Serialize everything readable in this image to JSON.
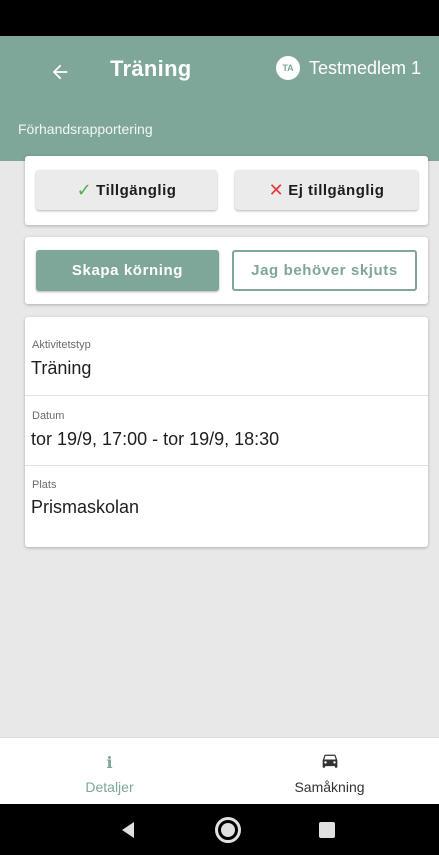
{
  "header": {
    "title": "Träning",
    "avatar_initials": "TA",
    "user_name": "Testmedlem 1",
    "subtitle": "Förhandsrapportering",
    "back_icon": "arrow-left-icon"
  },
  "availability": {
    "available_mark": "✓",
    "available_label": "Tillgänglig",
    "unavailable_mark": "✕",
    "unavailable_label": "Ej tillgänglig"
  },
  "carpool_actions": {
    "create_label": "Skapa körning",
    "need_ride_label": "Jag behöver skjuts"
  },
  "details": [
    {
      "label": "Aktivitetstyp",
      "value": "Träning"
    },
    {
      "label": "Datum",
      "value": "tor 19/9, 17:00 - tor 19/9, 18:30"
    },
    {
      "label": "Plats",
      "value": "Prismaskolan"
    }
  ],
  "bottom_nav": {
    "details_icon": "info-icon",
    "details_glyph": "i",
    "details_label": "Detaljer",
    "carpool_icon": "car-icon",
    "carpool_label": "Samåkning",
    "active": "Detaljer"
  },
  "colors": {
    "primary": "#7ea699",
    "available_green": "#4caf50",
    "unavailable_red": "#e53935",
    "background": "#e8e8e8"
  }
}
